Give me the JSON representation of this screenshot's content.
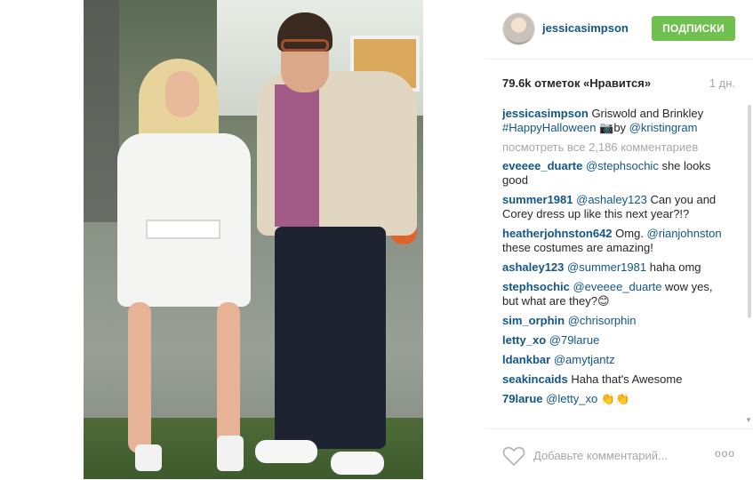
{
  "post": {
    "username": "jessicasimpson",
    "follow_label": "ПОДПИСКИ",
    "likes": "79.6k отметок «Нравится»",
    "time": "1 дн."
  },
  "caption": {
    "user": "jessicasimpson",
    "text1": " Griswold and Brinkley ",
    "hashtag": "#HappyHalloween",
    "camera_glyph": " 📷",
    "text2": "by ",
    "mention": "@kristingram"
  },
  "view_all": "посмотреть все 2,186 комментариев",
  "comments": [
    {
      "user": "eveeee_duarte",
      "mention": "@stephsochic",
      "text": " she looks good"
    },
    {
      "user": "summer1981",
      "mention": "@ashaley123",
      "text": " Can you and Corey dress up like this next year?!?"
    },
    {
      "user": "heatherjohnston642",
      "mention": "",
      "text": " Omg. ",
      "mention2": "@rianjohnston",
      "text2": " these costumes are amazing!"
    },
    {
      "user": "ashaley123",
      "mention": "@summer1981",
      "text": " haha omg"
    },
    {
      "user": "stephsochic",
      "mention": "@eveeee_duarte",
      "text": " wow yes, but what are they?😊"
    },
    {
      "user": "sim_orphin",
      "mention": "@chrisorphin",
      "text": ""
    },
    {
      "user": "letty_xo",
      "mention": "@79larue",
      "text": ""
    },
    {
      "user": "ldankbar",
      "mention": "@amytjantz",
      "text": ""
    },
    {
      "user": "seakincaids",
      "mention": "",
      "text": " Haha that's Awesome"
    },
    {
      "user": "79larue",
      "mention": "@letty_xo",
      "text": " 👏👏"
    }
  ],
  "footer": {
    "add_comment_placeholder": "Добавьте комментарий...",
    "more_glyph": "ooo"
  },
  "colors": {
    "follow": "#70c050",
    "link": "#125688",
    "muted": "#a5a7aa"
  },
  "icons": [
    "avatar",
    "heart-icon",
    "more-icon",
    "camera-icon"
  ]
}
